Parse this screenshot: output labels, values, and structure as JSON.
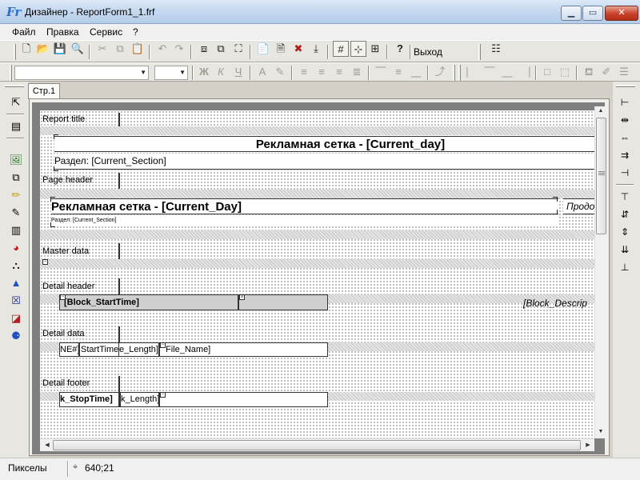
{
  "window": {
    "title": "Дизайнер - ReportForm1_1.frf",
    "icon": "fr-app-icon",
    "controls": [
      "minimize",
      "maximize",
      "close"
    ]
  },
  "menu": {
    "items": [
      "Файл",
      "Правка",
      "Сервис",
      "?"
    ]
  },
  "toolbar": {
    "exit_label": "Выход"
  },
  "formatting": {
    "font_name": "",
    "font_size": "",
    "bold_glyph": "Ж",
    "italic_glyph": "К",
    "underline_glyph": "Ч"
  },
  "tabs": [
    {
      "label": "Стр.1",
      "active": true
    }
  ],
  "bands": [
    {
      "name": "Report title"
    },
    {
      "name": "Page header"
    },
    {
      "name": "Master data"
    },
    {
      "name": "Detail header"
    },
    {
      "name": "Detail data"
    },
    {
      "name": "Detail footer"
    }
  ],
  "objects": {
    "report_title_main": "Рекламная сетка - [Current_day]",
    "report_title_section": "Раздел: [Current_Section]",
    "page_header_main": "Рекламная сетка - [Current_Day]",
    "page_header_right": "Продо",
    "page_header_section": "Раздел: [Current_Section]",
    "detail_header_start": "[Block_StartTime]",
    "detail_header_desc": "[Block_Descrip",
    "detail_data_cells": [
      "NE#]",
      "StartTime]",
      "e_Length]",
      "File_Name]"
    ],
    "detail_footer_cells": [
      "k_StopTime]",
      "k_Length]"
    ]
  },
  "statusbar": {
    "units": "Пикселы",
    "coords": "640;21"
  },
  "colors": {
    "titlebar": "#c4d8ef",
    "canvas_dots": "#6b6b6b",
    "close_button": "#c7412a"
  }
}
